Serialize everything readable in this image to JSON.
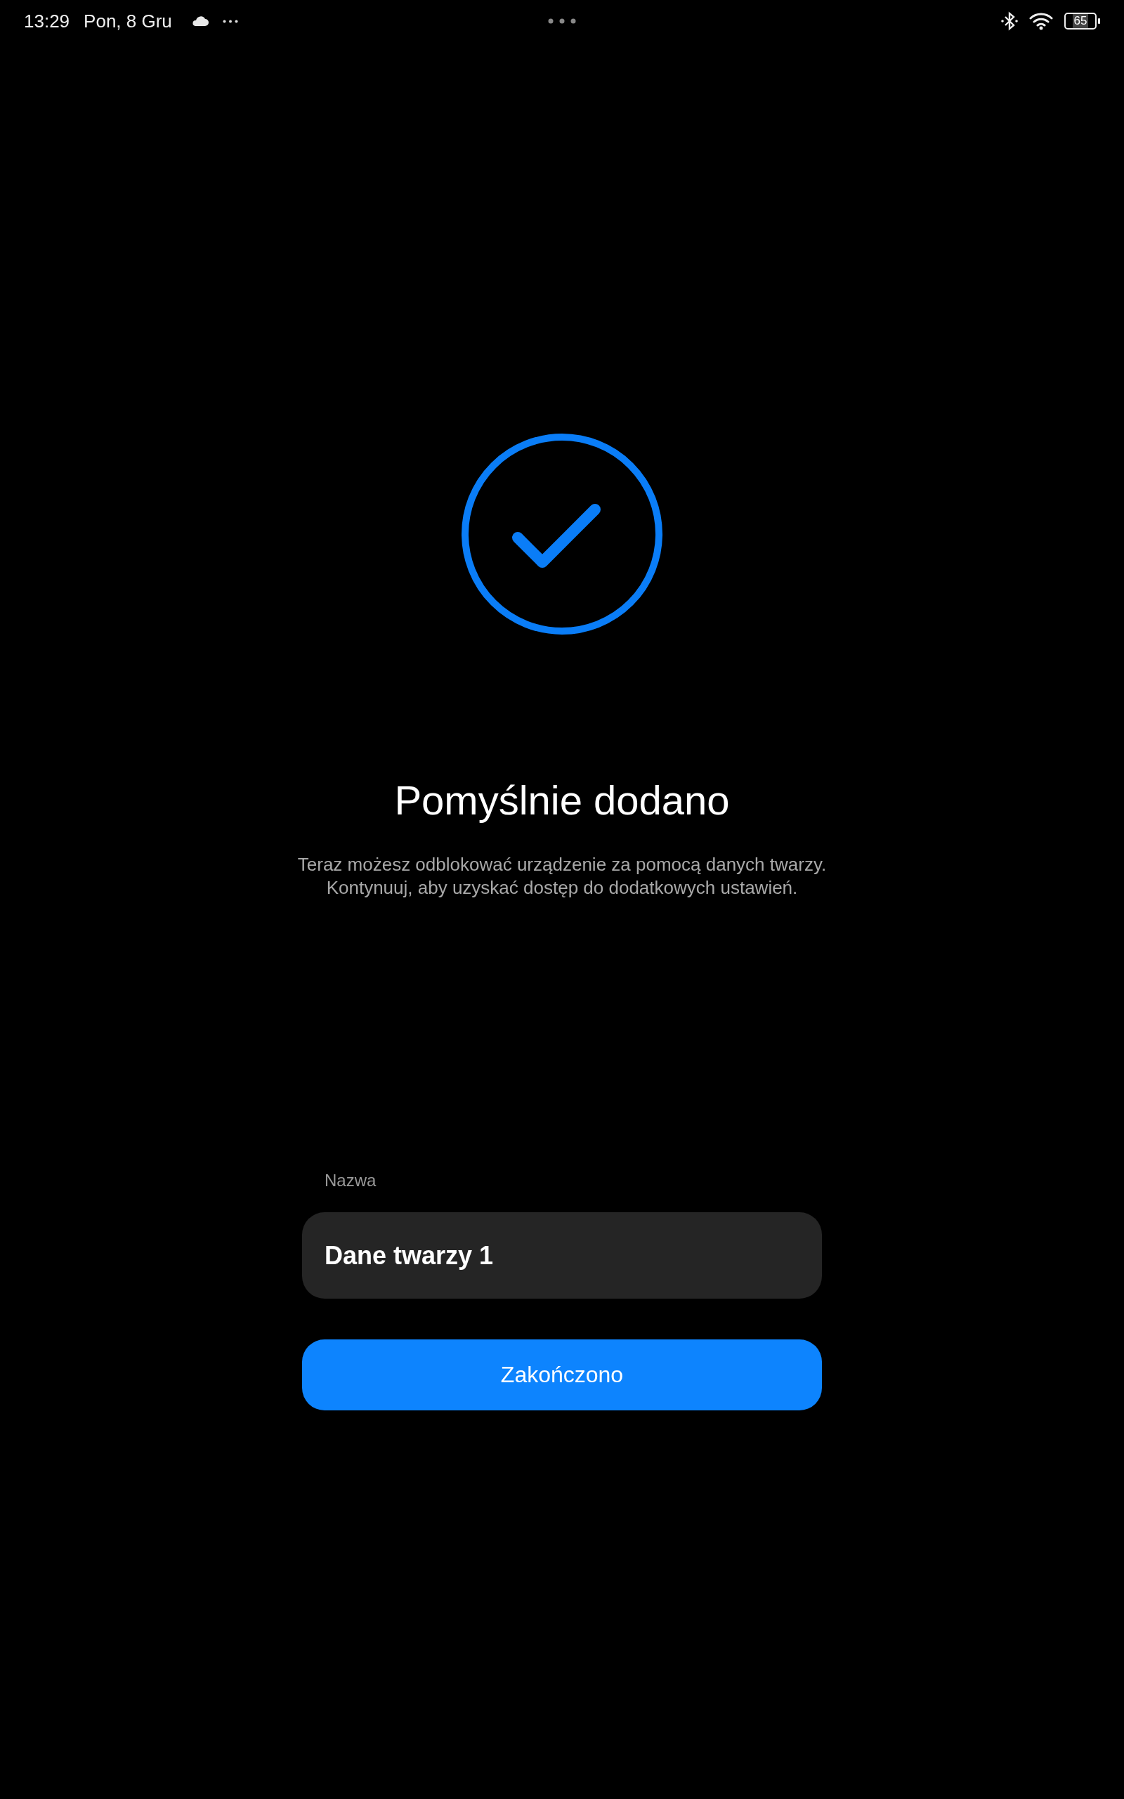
{
  "status_bar": {
    "time": "13:29",
    "date": "Pon, 8 Gru",
    "battery": "65"
  },
  "title": "Pomyślnie dodano",
  "description": [
    "Teraz możesz odblokować urządzenie za pomocą danych twarzy.",
    "Kontynuuj, aby uzyskać dostęp do dodatkowych ustawień."
  ],
  "name_field": {
    "label": "Nazwa",
    "value": "Dane twarzy 1"
  },
  "buttons": [
    "Zakończono"
  ]
}
